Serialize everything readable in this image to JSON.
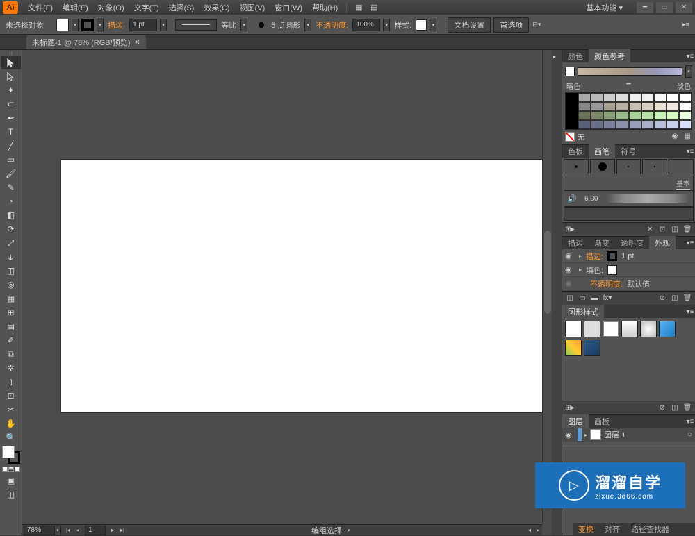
{
  "menubar": {
    "logo": "Ai",
    "items": [
      "文件(F)",
      "编辑(E)",
      "对象(O)",
      "文字(T)",
      "选择(S)",
      "效果(C)",
      "视图(V)",
      "窗口(W)",
      "帮助(H)"
    ],
    "workspace": "基本功能 ▾"
  },
  "controlbar": {
    "selection_label": "未选择对象",
    "stroke_label": "描边:",
    "stroke_weight": "1 pt",
    "uniform": "等比",
    "profile": "5 点圆形",
    "opacity_label": "不透明度:",
    "opacity_value": "100%",
    "style_label": "样式:",
    "doc_setup": "文档设置",
    "prefs": "首选项"
  },
  "tab": {
    "title": "未标题-1 @ 78% (RGB/预览)"
  },
  "statusbar": {
    "zoom": "78%",
    "artboard": "1",
    "mode": "编组选择"
  },
  "panels": {
    "color": {
      "tabs": [
        "颜色",
        "颜色参考"
      ],
      "darker": "暗色",
      "lighter": "淡色",
      "none": "无"
    },
    "swatches": {
      "tabs": [
        "色板",
        "画笔",
        "符号"
      ],
      "basic": "基本",
      "width": "6.00"
    },
    "appearance": {
      "tabs": [
        "描边",
        "渐变",
        "透明度",
        "外观"
      ],
      "stroke_label": "描边:",
      "stroke_val": "1 pt",
      "fill_label": "填色:",
      "opacity_label": "不透明度:",
      "opacity_val": "默认值"
    },
    "graphic_styles": {
      "tab": "图形样式"
    },
    "layers": {
      "tabs": [
        "图层",
        "画板"
      ],
      "layer_name": "图层 1"
    },
    "bottom": {
      "tabs": [
        "变换",
        "对齐",
        "路径查找器"
      ]
    }
  },
  "watermark": {
    "title": "溜溜自学",
    "url": "zixue.3d66.com"
  }
}
